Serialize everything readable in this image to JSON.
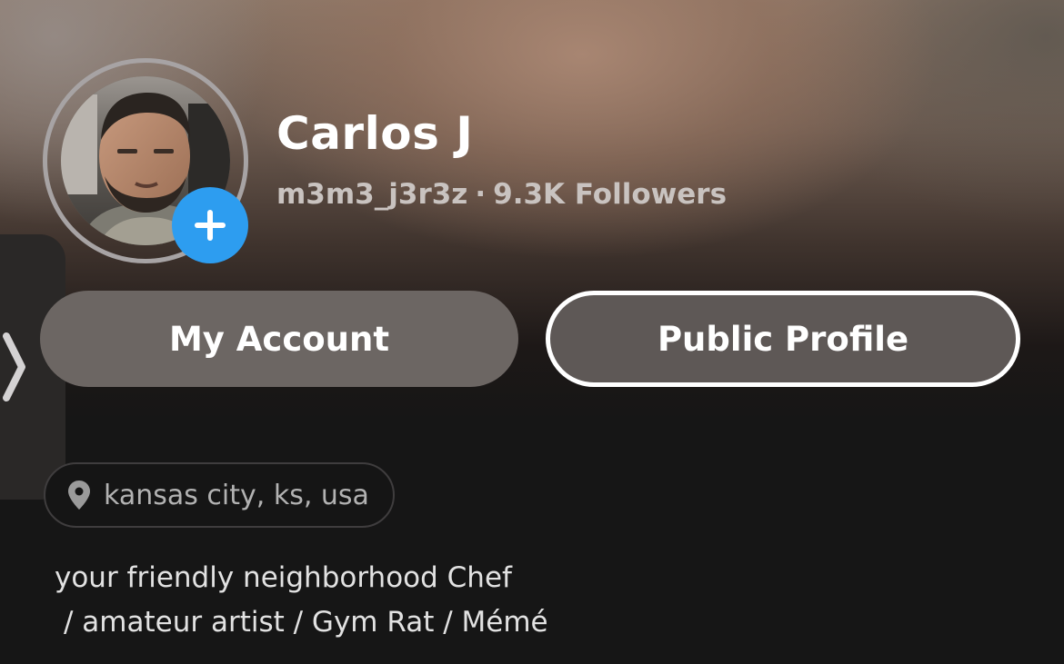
{
  "profile": {
    "display_name": "Carlos J",
    "username": "m3m3_j3r3z",
    "separator": "·",
    "followers": "9.3K Followers",
    "location": "kansas city, ks, usa",
    "bio_lines": [
      "your friendly neighborhood Chef",
      "/ amateur artist / Gym Rat / Mémé"
    ]
  },
  "actions": {
    "my_account_label": "My Account",
    "public_profile_label": "Public Profile"
  },
  "icons": {
    "add_friend": "plus-icon",
    "side_tab": "chevron-right-icon",
    "location": "location-pin-icon"
  },
  "colors": {
    "accent_blue": "#2d9df0",
    "background": "#161616"
  }
}
